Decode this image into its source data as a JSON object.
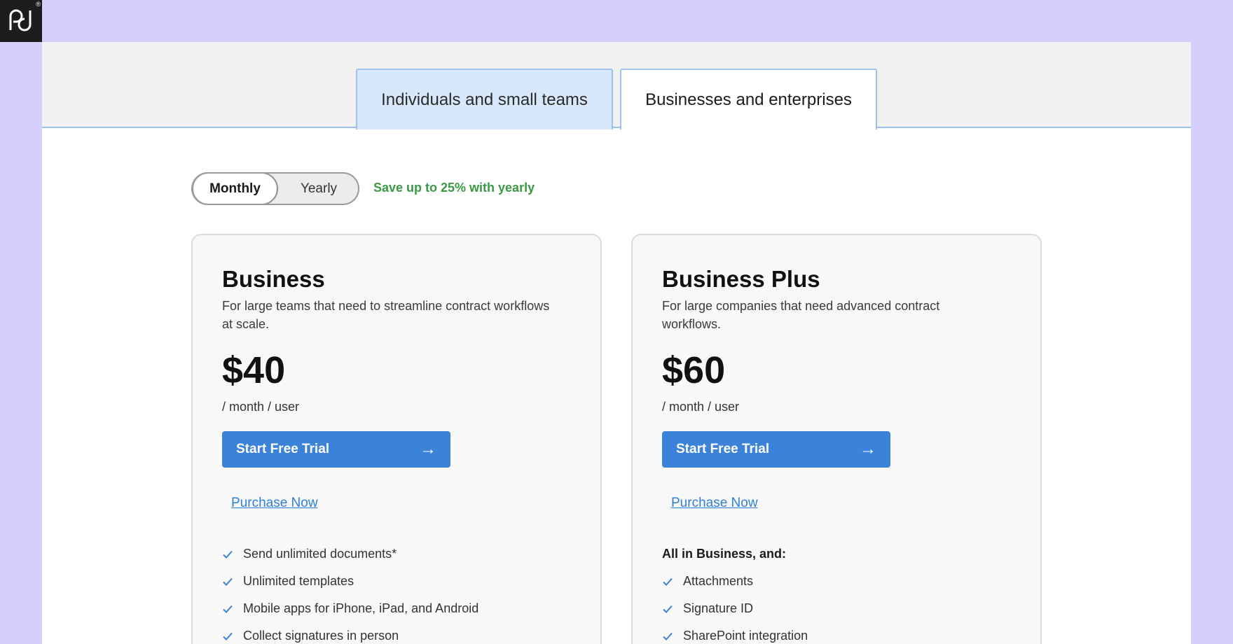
{
  "tabs": [
    {
      "label": "Individuals and small teams",
      "active": false
    },
    {
      "label": "Businesses and enterprises",
      "active": true
    }
  ],
  "billing": {
    "monthly_label": "Monthly",
    "yearly_label": "Yearly",
    "selected": "Monthly",
    "save_note": "Save up to 25% with yearly"
  },
  "plans": [
    {
      "name": "Business",
      "description": "For large teams that need to streamline contract workflows at scale.",
      "price": "$40",
      "unit": "/ month / user",
      "cta_label": "Start Free Trial",
      "purchase_label": "Purchase Now",
      "features_heading": "",
      "features": [
        "Send unlimited documents*",
        "Unlimited templates",
        "Mobile apps for iPhone, iPad, and Android",
        "Collect signatures in person"
      ]
    },
    {
      "name": "Business Plus",
      "description": "For large companies that need advanced contract workflows.",
      "price": "$60",
      "unit": "/ month / user",
      "cta_label": "Start Free Trial",
      "purchase_label": "Purchase Now",
      "features_heading": "All in Business, and:",
      "features": [
        "Attachments",
        "Signature ID",
        "SharePoint integration"
      ]
    }
  ],
  "colors": {
    "background": "#d6cffe",
    "accent": "#3b82d9",
    "save_green": "#3a9a43",
    "tab_border": "#9fc1ef"
  },
  "icons": {
    "logo": "pd-logo",
    "cta": "arrow-right-icon",
    "feature": "check-icon"
  }
}
